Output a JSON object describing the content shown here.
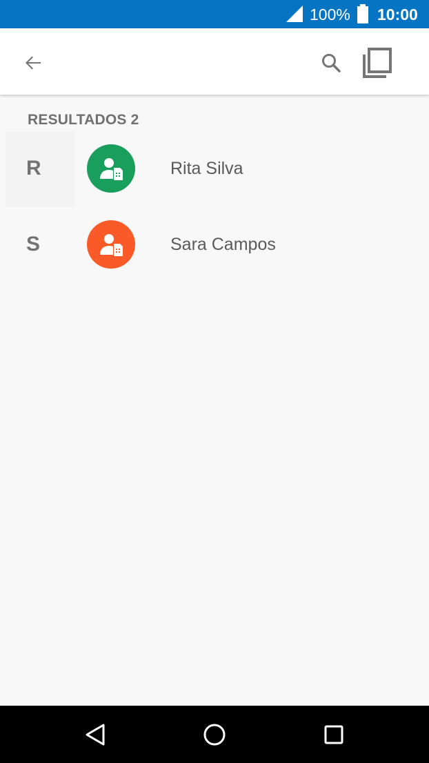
{
  "status_bar": {
    "battery_percent": "100%",
    "time": "10:00"
  },
  "app_bar": {
    "back_icon": "arrow-back-icon",
    "search_icon": "search-icon",
    "copy_icon": "copy-icon"
  },
  "results": {
    "header": "RESULTADOS 2"
  },
  "contacts": [
    {
      "letter": "R",
      "name": "Rita Silva",
      "avatar_color": "#1a9e5c",
      "icon": "sim-contact-icon"
    },
    {
      "letter": "S",
      "name": "Sara Campos",
      "avatar_color": "#fa5a28",
      "icon": "sim-contact-icon"
    }
  ],
  "colors": {
    "status_bar": "#0575c3",
    "background": "#f8f8f8",
    "text_secondary": "#707070"
  }
}
